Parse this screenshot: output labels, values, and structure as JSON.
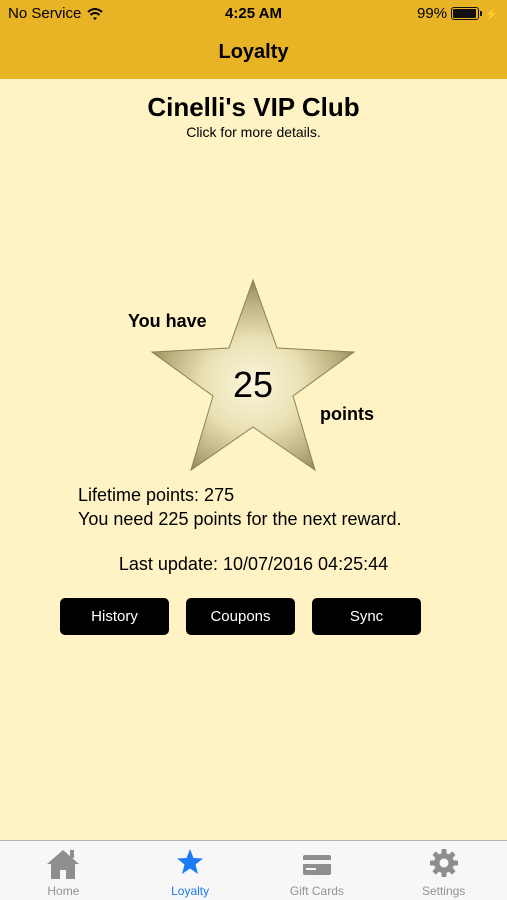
{
  "status": {
    "carrier": "No Service",
    "time": "4:25 AM",
    "battery": "99%"
  },
  "nav": {
    "title": "Loyalty"
  },
  "club": {
    "title": "Cinelli's VIP Club",
    "subtitle": "Click for more details."
  },
  "points": {
    "prefix": "You have",
    "value": "25",
    "suffix": "points"
  },
  "info": {
    "lifetime": "Lifetime points: 275",
    "next_reward": "You need 225 points for the next reward.",
    "last_update": "Last update: 10/07/2016 04:25:44"
  },
  "buttons": {
    "history": "History",
    "coupons": "Coupons",
    "sync": "Sync"
  },
  "tabs": [
    {
      "label": "Home",
      "icon": "home-icon"
    },
    {
      "label": "Loyalty",
      "icon": "star-icon"
    },
    {
      "label": "Gift Cards",
      "icon": "gift-card-icon"
    },
    {
      "label": "Settings",
      "icon": "gear-icon"
    }
  ],
  "colors": {
    "header": "#e8b325",
    "background": "#fff2c5",
    "active_tab": "#1b7cf5",
    "inactive_tab": "#929292"
  }
}
